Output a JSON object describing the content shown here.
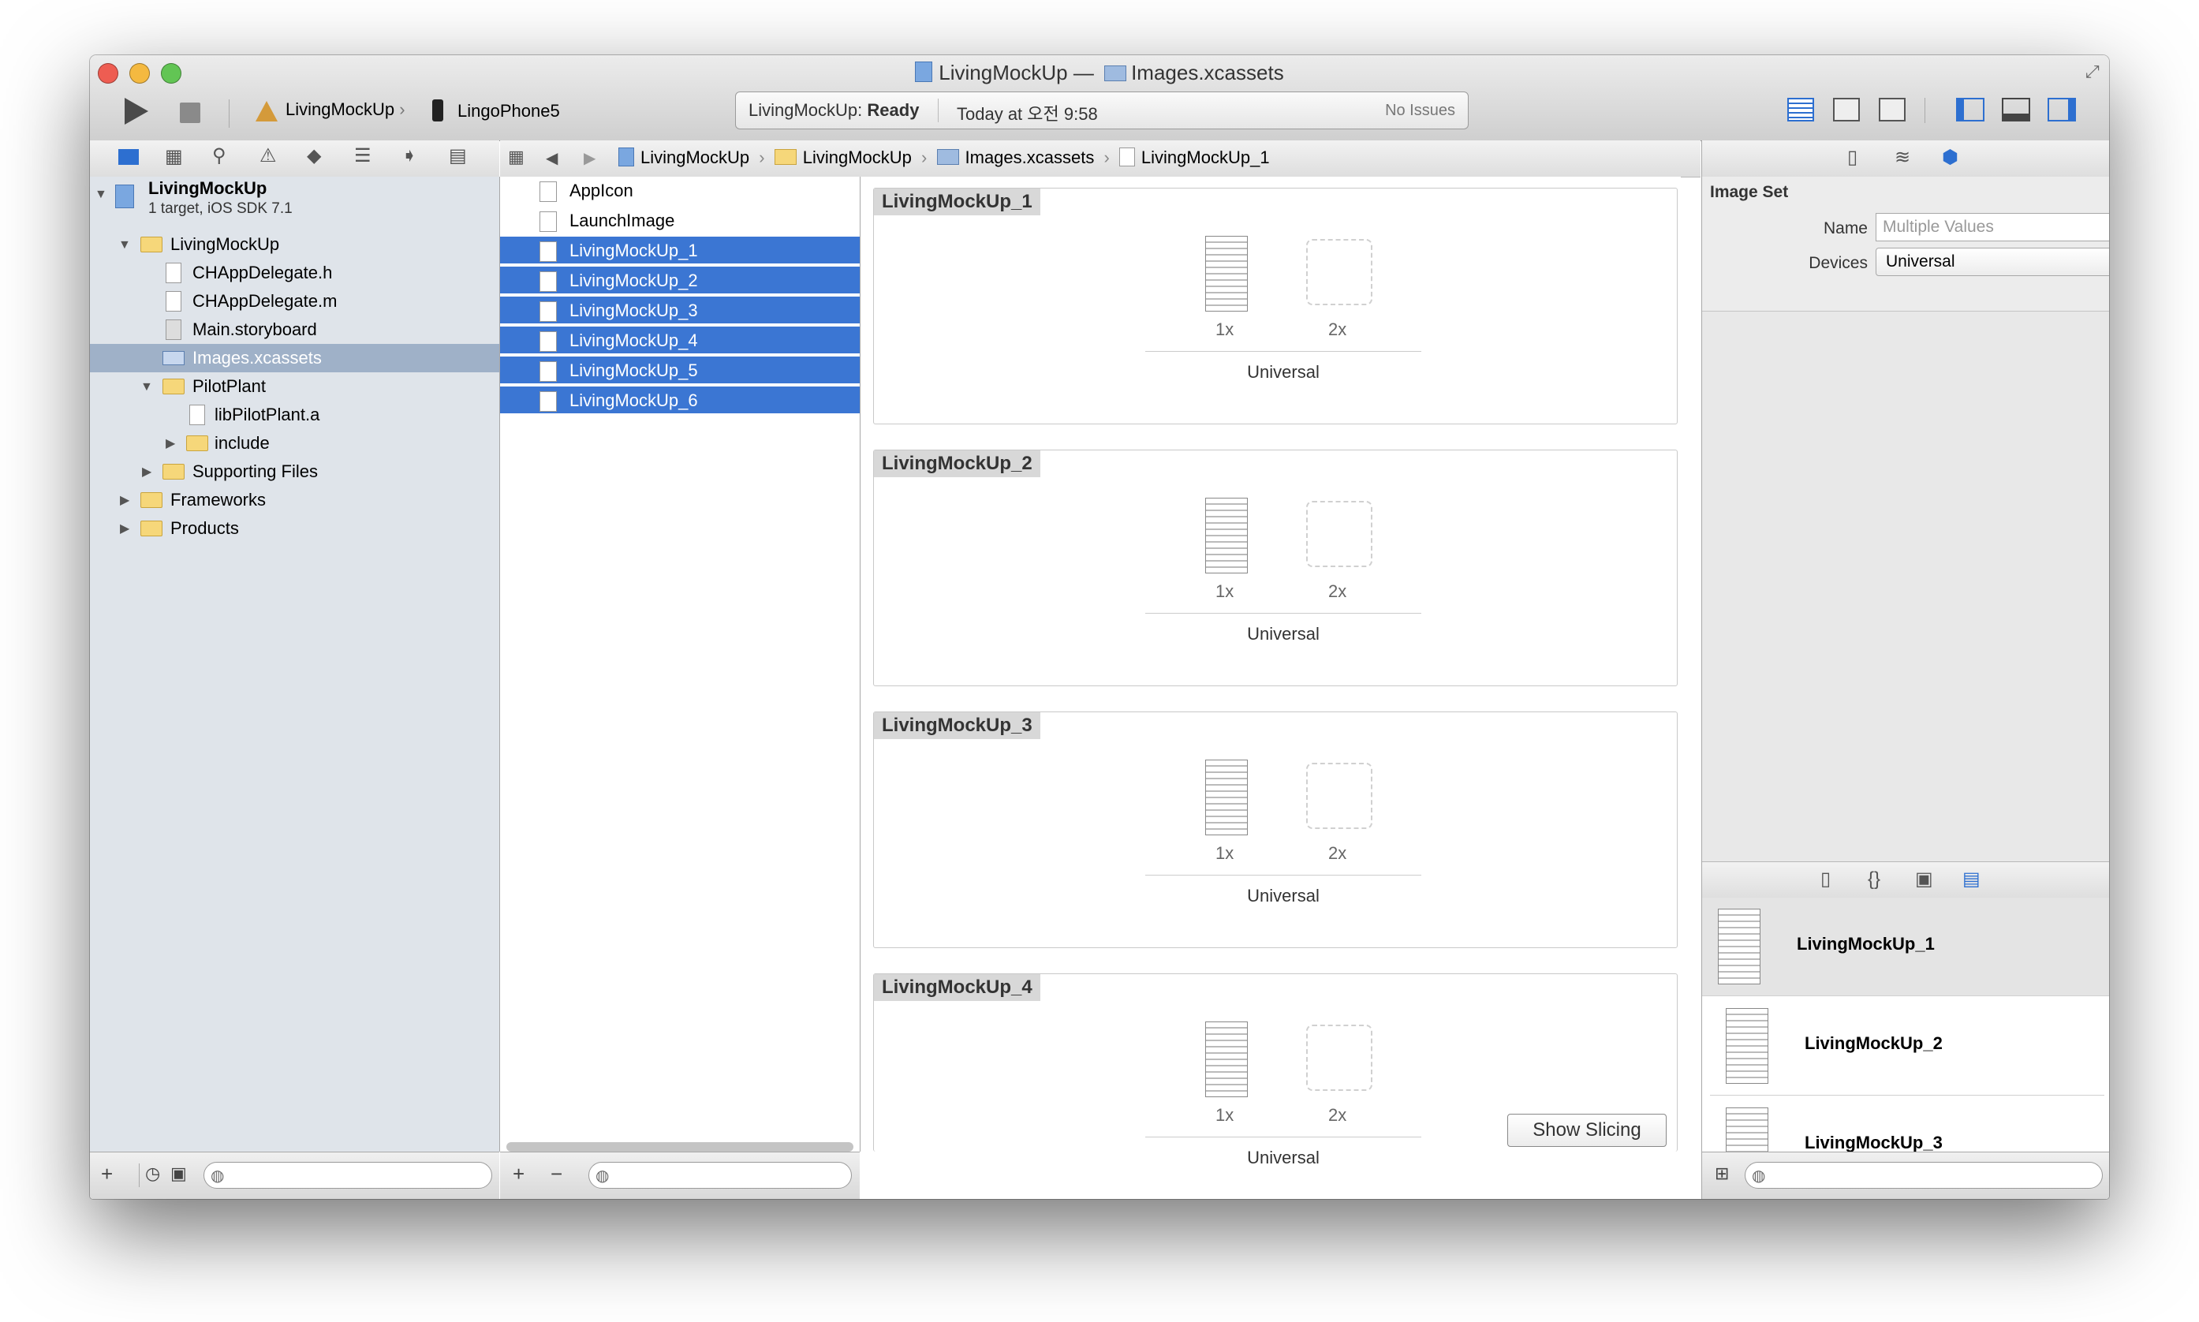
{
  "window": {
    "title": "LivingMockUp",
    "title_separator": "—",
    "title_file": "Images.xcassets"
  },
  "toolbar": {
    "scheme": "LivingMockUp",
    "device": "LingoPhone5",
    "status_project": "LivingMockUp:",
    "status_state": "Ready",
    "status_time": "Today at 오전 9:58",
    "status_issues": "No Issues"
  },
  "navigator": {
    "project_name": "LivingMockUp",
    "project_subtitle": "1 target, iOS SDK 7.1",
    "items": [
      {
        "label": "LivingMockUp",
        "kind": "folder"
      },
      {
        "label": "CHAppDelegate.h",
        "kind": "file"
      },
      {
        "label": "CHAppDelegate.m",
        "kind": "file"
      },
      {
        "label": "Main.storyboard",
        "kind": "file"
      },
      {
        "label": "Images.xcassets",
        "kind": "asset",
        "selected": true
      },
      {
        "label": "PilotPlant",
        "kind": "folder"
      },
      {
        "label": "libPilotPlant.a",
        "kind": "file"
      },
      {
        "label": "include",
        "kind": "folder"
      },
      {
        "label": "Supporting Files",
        "kind": "folder"
      },
      {
        "label": "Frameworks",
        "kind": "folder"
      },
      {
        "label": "Products",
        "kind": "folder"
      }
    ]
  },
  "jumpbar": {
    "crumbs": [
      "LivingMockUp",
      "LivingMockUp",
      "Images.xcassets",
      "LivingMockUp_1"
    ]
  },
  "assets": {
    "items": [
      {
        "label": "AppIcon",
        "selected": false
      },
      {
        "label": "LaunchImage",
        "selected": false
      },
      {
        "label": "LivingMockUp_1",
        "selected": true
      },
      {
        "label": "LivingMockUp_2",
        "selected": true
      },
      {
        "label": "LivingMockUp_3",
        "selected": true
      },
      {
        "label": "LivingMockUp_4",
        "selected": true
      },
      {
        "label": "LivingMockUp_5",
        "selected": true
      },
      {
        "label": "LivingMockUp_6",
        "selected": true
      }
    ],
    "add_button": "+",
    "remove_button": "−"
  },
  "editor": {
    "sets": [
      {
        "name": "LivingMockUp_1",
        "scale1": "1x",
        "scale2": "2x",
        "device": "Universal"
      },
      {
        "name": "LivingMockUp_2",
        "scale1": "1x",
        "scale2": "2x",
        "device": "Universal"
      },
      {
        "name": "LivingMockUp_3",
        "scale1": "1x",
        "scale2": "2x",
        "device": "Universal"
      },
      {
        "name": "LivingMockUp_4",
        "scale1": "1x",
        "scale2": "2x",
        "device": "Universal"
      }
    ],
    "show_slicing": "Show Slicing"
  },
  "inspector": {
    "section_title": "Image Set",
    "name_label": "Name",
    "name_placeholder": "Multiple Values",
    "devices_label": "Devices",
    "devices_value": "Universal",
    "library_items": [
      "LivingMockUp_1",
      "LivingMockUp_2",
      "LivingMockUp_3"
    ]
  },
  "colors": {
    "selection_blue": "#3b76d3",
    "navigator_bg": "#dfe4ea",
    "close": "#ee5d52",
    "minimize": "#f4b940",
    "zoom": "#62c554"
  }
}
